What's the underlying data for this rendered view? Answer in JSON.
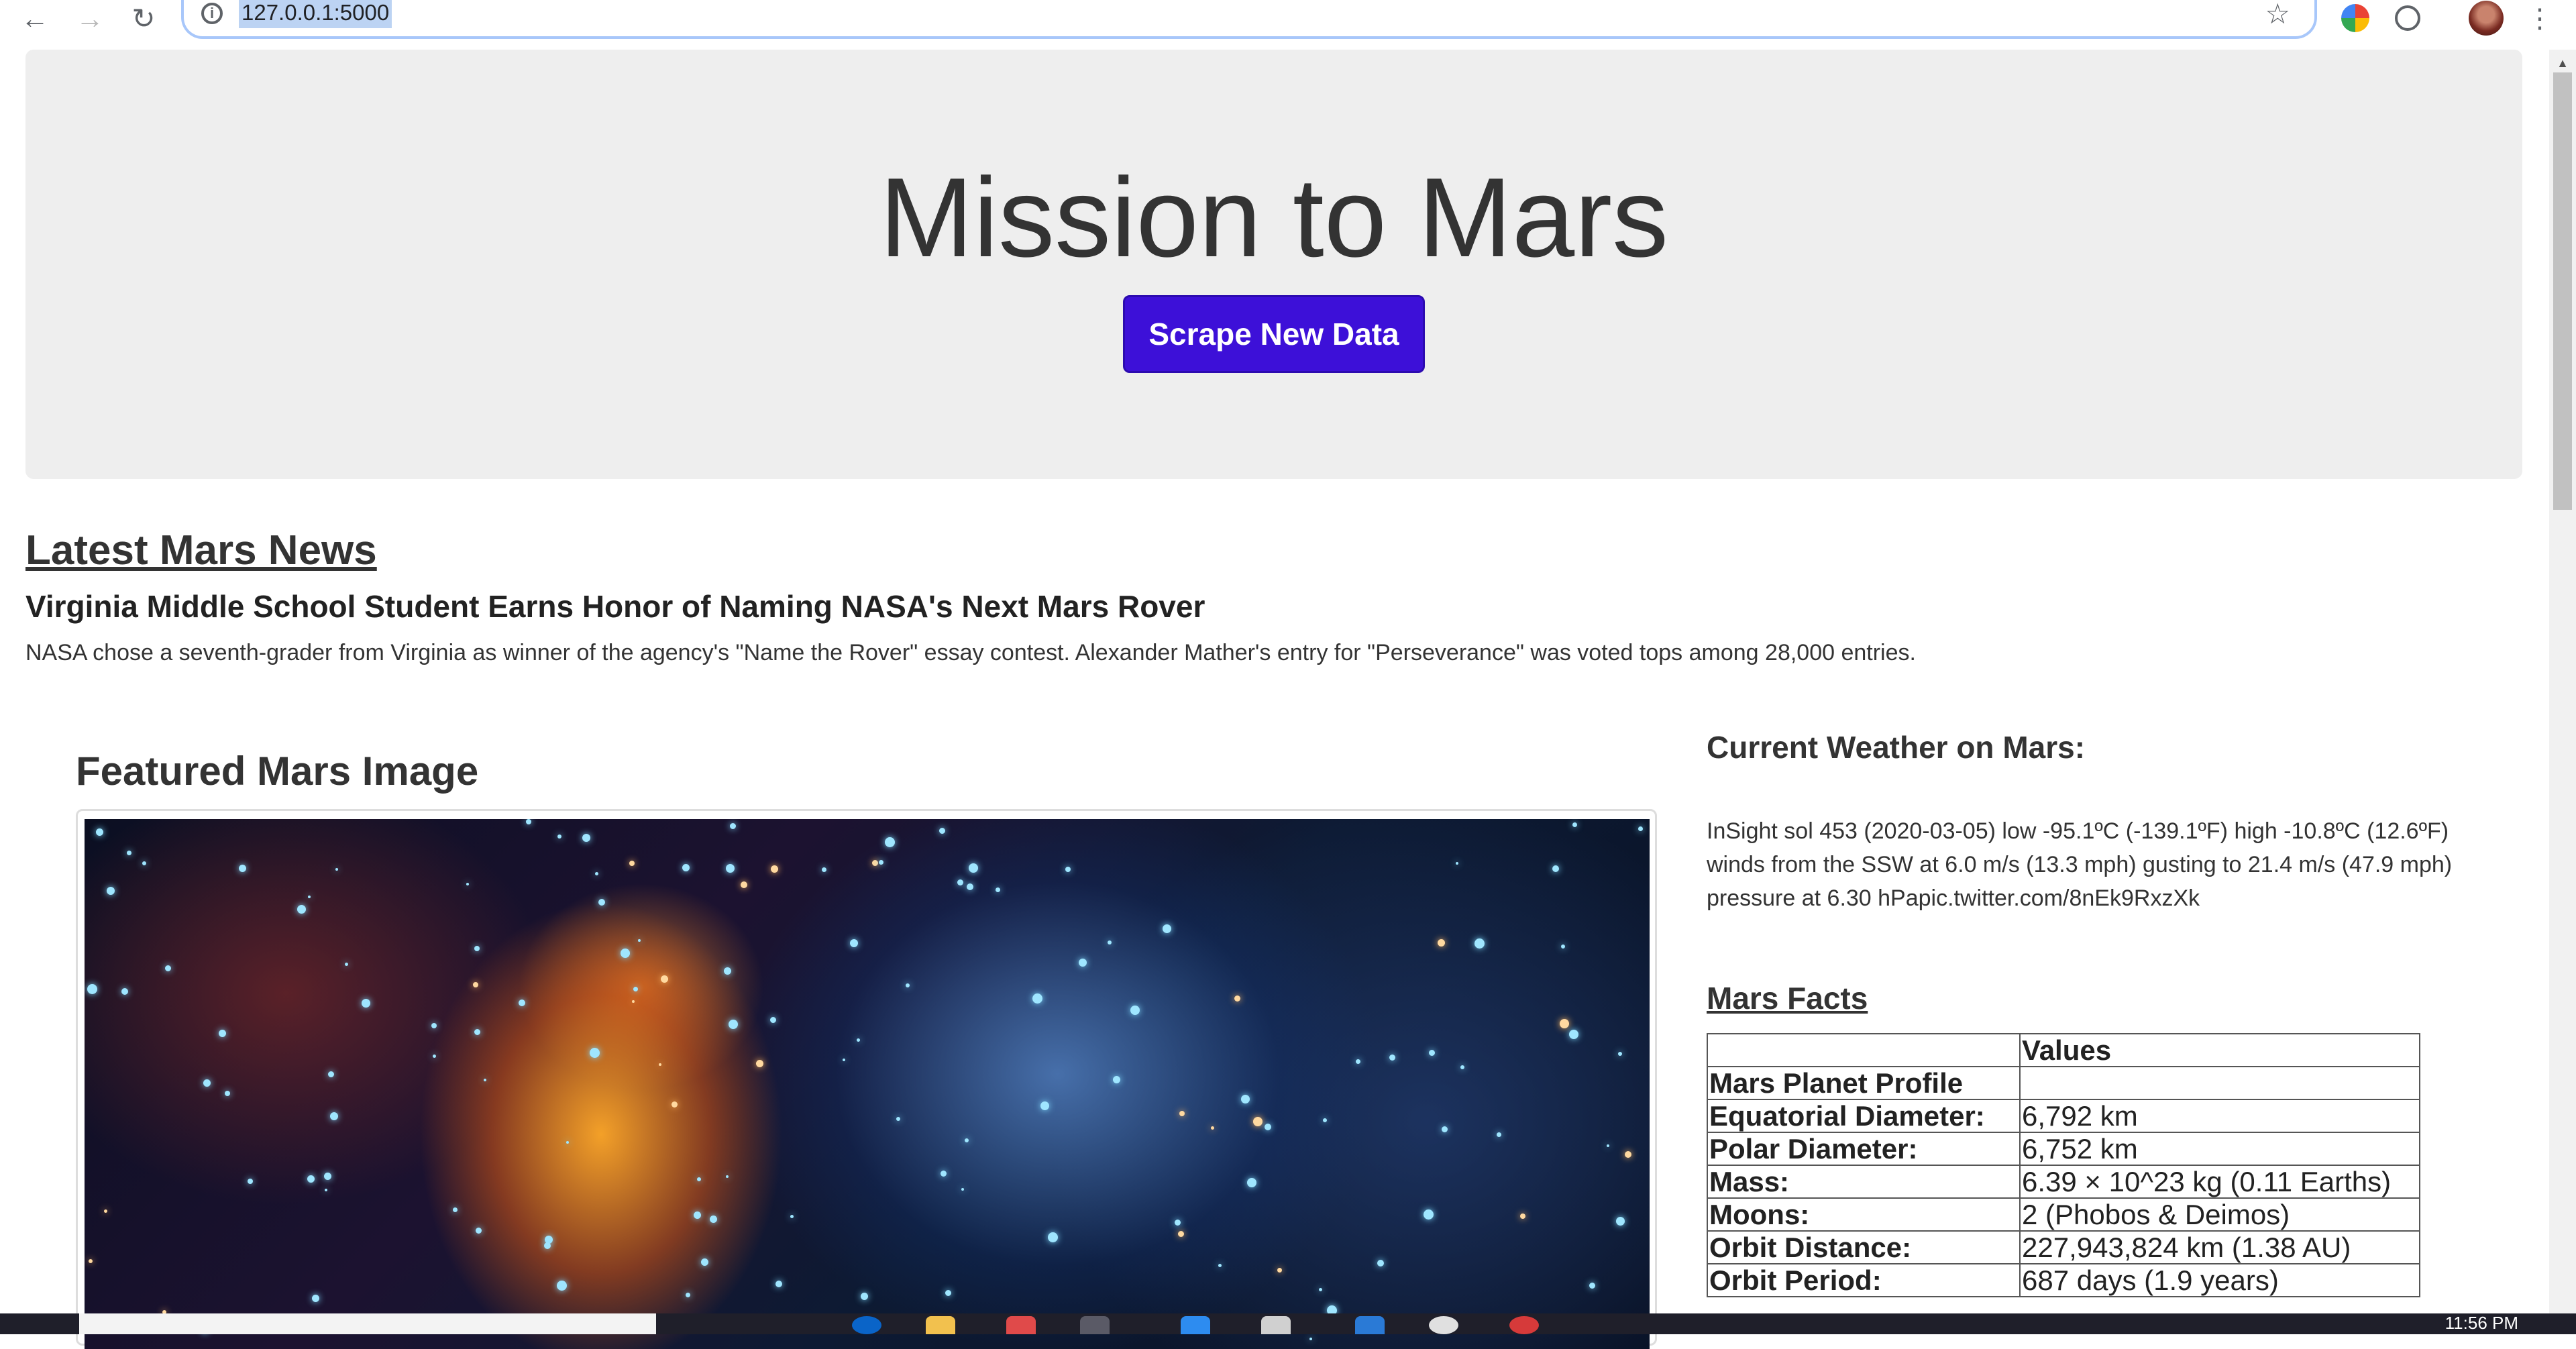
{
  "browser": {
    "url": "127.0.0.1:5000",
    "icons": [
      "back-icon",
      "forward-icon",
      "reload-icon",
      "info-icon",
      "star-icon",
      "extension-icon",
      "profile-avatar",
      "menu-dots-icon"
    ]
  },
  "header": {
    "title": "Mission to Mars",
    "button_label": "Scrape New Data",
    "button_color": "#3d10d8"
  },
  "news": {
    "heading": "Latest Mars News",
    "title": "Virginia Middle School Student Earns Honor of Naming NASA's Next Mars Rover",
    "paragraph": "NASA chose a seventh-grader from Virginia as winner of the agency's \"Name the Rover\" essay contest. Alexander Mather's entry for \"Perseverance\" was voted tops among 28,000 entries."
  },
  "featured": {
    "heading": "Featured Mars Image"
  },
  "weather": {
    "heading": "Current Weather on Mars:",
    "text": "InSight sol 453 (2020-03-05) low -95.1ºC (-139.1ºF) high -10.8ºC (12.6ºF) winds from the SSW at 6.0 m/s (13.3 mph) gusting to 21.4 m/s (47.9 mph) pressure at 6.30 hPapic.twitter.com/8nEk9RxzXk"
  },
  "facts": {
    "heading": "Mars Facts",
    "header": [
      "",
      "Values"
    ],
    "rows": [
      [
        "Mars Planet Profile",
        ""
      ],
      [
        "Equatorial Diameter:",
        "6,792 km"
      ],
      [
        "Polar Diameter:",
        "6,752 km"
      ],
      [
        "Mass:",
        "6.39 × 10^23 kg (0.11 Earths)"
      ],
      [
        "Moons:",
        "2 (Phobos & Deimos)"
      ],
      [
        "Orbit Distance:",
        "227,943,824 km (1.38 AU)"
      ],
      [
        "Orbit Period:",
        "687 days (1.9 years)"
      ]
    ]
  },
  "taskbar": {
    "clock": "11:56 PM"
  }
}
